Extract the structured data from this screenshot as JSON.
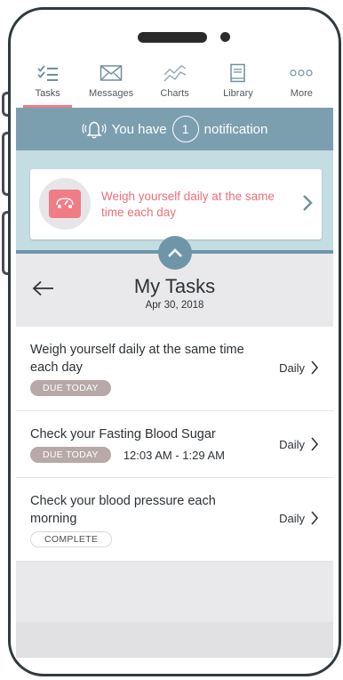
{
  "tabs": [
    {
      "label": "Tasks",
      "icon": "checklist-icon",
      "active": true
    },
    {
      "label": "Messages",
      "icon": "envelope-icon",
      "active": false
    },
    {
      "label": "Charts",
      "icon": "chart-line-icon",
      "active": false
    },
    {
      "label": "Library",
      "icon": "book-icon",
      "active": false
    },
    {
      "label": "More",
      "icon": "more-dots-icon",
      "active": false
    }
  ],
  "notification": {
    "prefix": "You have",
    "count": "1",
    "suffix": "notification",
    "card_text": "Weigh yourself daily at the same time each day"
  },
  "header": {
    "title": "My Tasks",
    "date": "Apr 30, 2018"
  },
  "tasks": [
    {
      "name": "Weigh yourself daily at the same time each day",
      "badge": "DUE TODAY",
      "time": "",
      "frequency": "Daily"
    },
    {
      "name": "Check your Fasting Blood Sugar",
      "badge": "DUE TODAY",
      "time": "12:03 AM - 1:29 AM",
      "frequency": "Daily"
    },
    {
      "name": "Check your blood pressure each morning",
      "badge": "COMPLETE",
      "time": "",
      "frequency": "Daily"
    }
  ],
  "colors": {
    "accent": "#ef7b86",
    "notif_strip": "#7c9fb0",
    "notif_band": "#c4dde2",
    "badge_due": "#b8a8a8"
  }
}
